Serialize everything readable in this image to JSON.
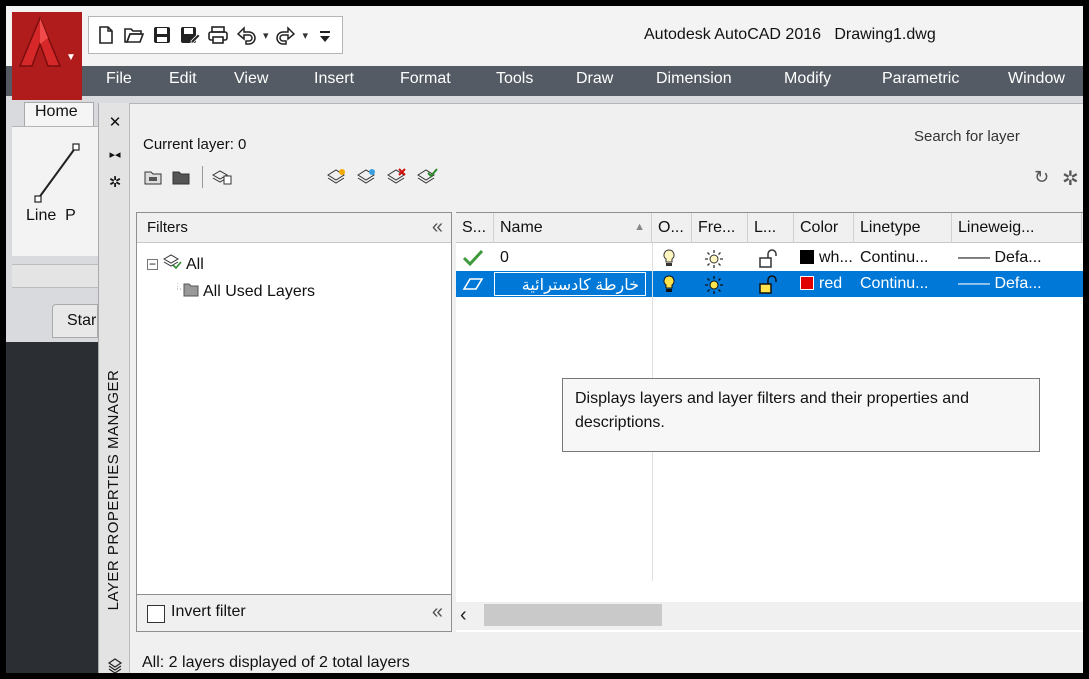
{
  "title_bar": {
    "title": "Autodesk AutoCAD 2016   Drawing1.dwg",
    "quick_access": [
      "new-icon",
      "open-icon",
      "save-icon",
      "save-as-icon",
      "plot-icon",
      "undo-icon",
      "redo-icon",
      "customize-icon"
    ]
  },
  "menu": {
    "items": [
      "File",
      "Edit",
      "View",
      "Insert",
      "Format",
      "Tools",
      "Draw",
      "Dimension",
      "Modify",
      "Parametric",
      "Window"
    ]
  },
  "ribbon": {
    "home_tab": "Home",
    "line_label": "Line  P",
    "start_tab": "Star"
  },
  "palette": {
    "title": "LAYER PROPERTIES MANAGER",
    "current_layer": "Current layer: 0",
    "search_placeholder": "Search for layer",
    "filters": {
      "header": "Filters",
      "tree": [
        "All",
        "All Used Layers"
      ],
      "invert_label": "Invert filter"
    },
    "columns": [
      "S...",
      "Name",
      "O...",
      "Fre...",
      "L...",
      "Color",
      "Linetype",
      "Lineweig..."
    ],
    "rows": [
      {
        "name": "0",
        "color_label": "wh...",
        "color_hex": "#000000",
        "linetype": "Continu...",
        "lineweight": "—— Defa...",
        "selected": false
      },
      {
        "name": "خارطة كادسترائية",
        "color_label": "red",
        "color_hex": "#e00000",
        "linetype": "Continu...",
        "lineweight": "—— Defa...",
        "selected": true
      }
    ],
    "tooltip": "Displays layers and layer filters and their properties and descriptions.",
    "status": "All: 2 layers displayed of 2 total layers"
  },
  "colors": {
    "menu_bg": "#545b64",
    "selection": "#0078d7",
    "logo_red": "#b01c1c"
  }
}
